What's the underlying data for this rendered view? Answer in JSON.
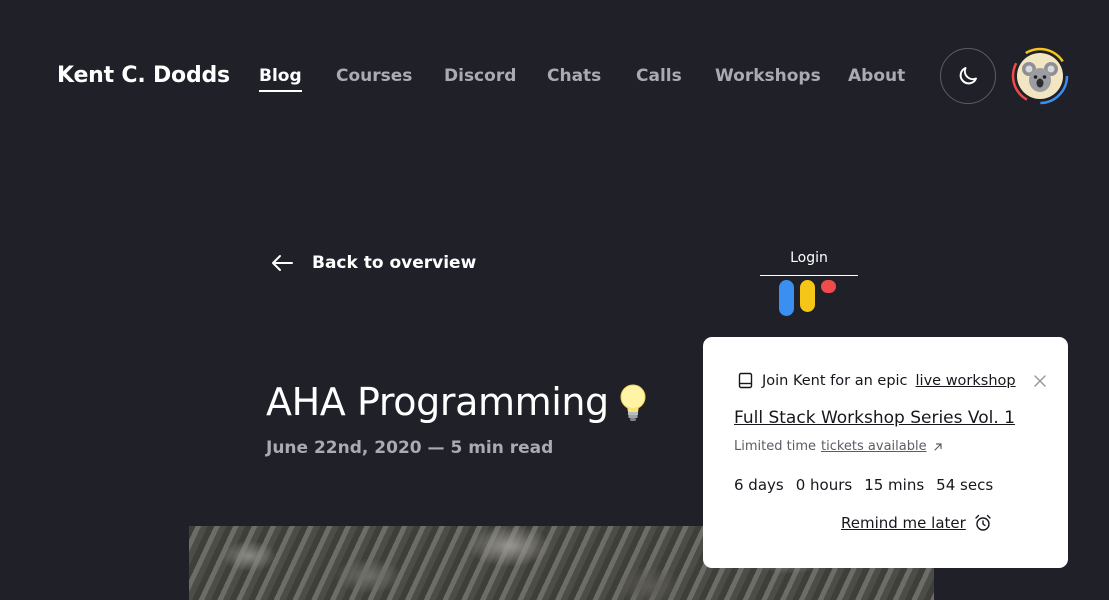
{
  "header": {
    "logo": "Kent C. Dodds",
    "nav": [
      "Blog",
      "Courses",
      "Discord",
      "Chats",
      "Calls",
      "Workshops",
      "About"
    ],
    "active_nav": "Blog",
    "theme_icon": "moon-icon",
    "avatar_icon": "koala-avatar"
  },
  "back_link": {
    "icon": "arrow-left-icon",
    "label": "Back to overview"
  },
  "login": {
    "label": "Login",
    "bar_colors": [
      "#3b8ff0",
      "#f5c518",
      "#f04b4b"
    ]
  },
  "post": {
    "title": "AHA Programming",
    "title_icon": "lightbulb-icon",
    "date": "June 22nd, 2020",
    "separator": "—",
    "read_time": "5 min read"
  },
  "popup": {
    "icon": "book-icon",
    "intro": "Join Kent for an epic",
    "intro_link": "live workshop",
    "close_icon": "close-icon",
    "title": "Full Stack Workshop Series Vol. 1",
    "limited": "Limited time",
    "tickets_link": "tickets available",
    "external_icon": "external-link-icon",
    "countdown": [
      "6 days",
      "0 hours",
      "15 mins",
      "54 secs"
    ],
    "remind": "Remind me later",
    "remind_icon": "alarm-clock-icon"
  },
  "colors": {
    "background": "#1f2028",
    "nav_inactive": "#a9abb3",
    "popup_bg": "#ffffff"
  }
}
